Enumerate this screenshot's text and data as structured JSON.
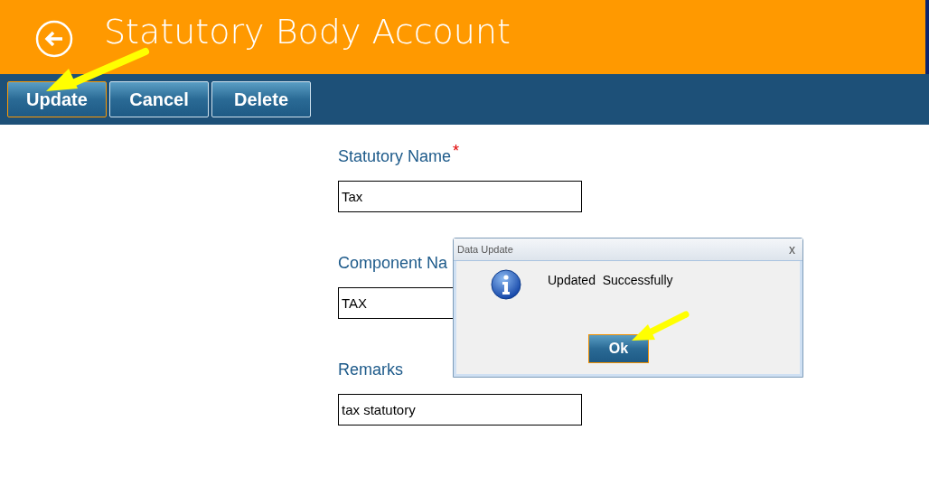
{
  "header": {
    "title": "Statutory Body Account"
  },
  "toolbar": [
    {
      "label": "Update",
      "selected": true
    },
    {
      "label": "Cancel",
      "selected": false
    },
    {
      "label": "Delete",
      "selected": false
    }
  ],
  "fields": [
    {
      "label": "Statutory Name",
      "required_mark": "*",
      "value": "Tax"
    },
    {
      "label": "Component Na",
      "value": "TAX"
    },
    {
      "label": "Remarks",
      "value": "tax statutory"
    }
  ],
  "dialog": {
    "title": "Data Update",
    "close": "x",
    "message": "Updated  Successfully",
    "button": "Ok"
  }
}
